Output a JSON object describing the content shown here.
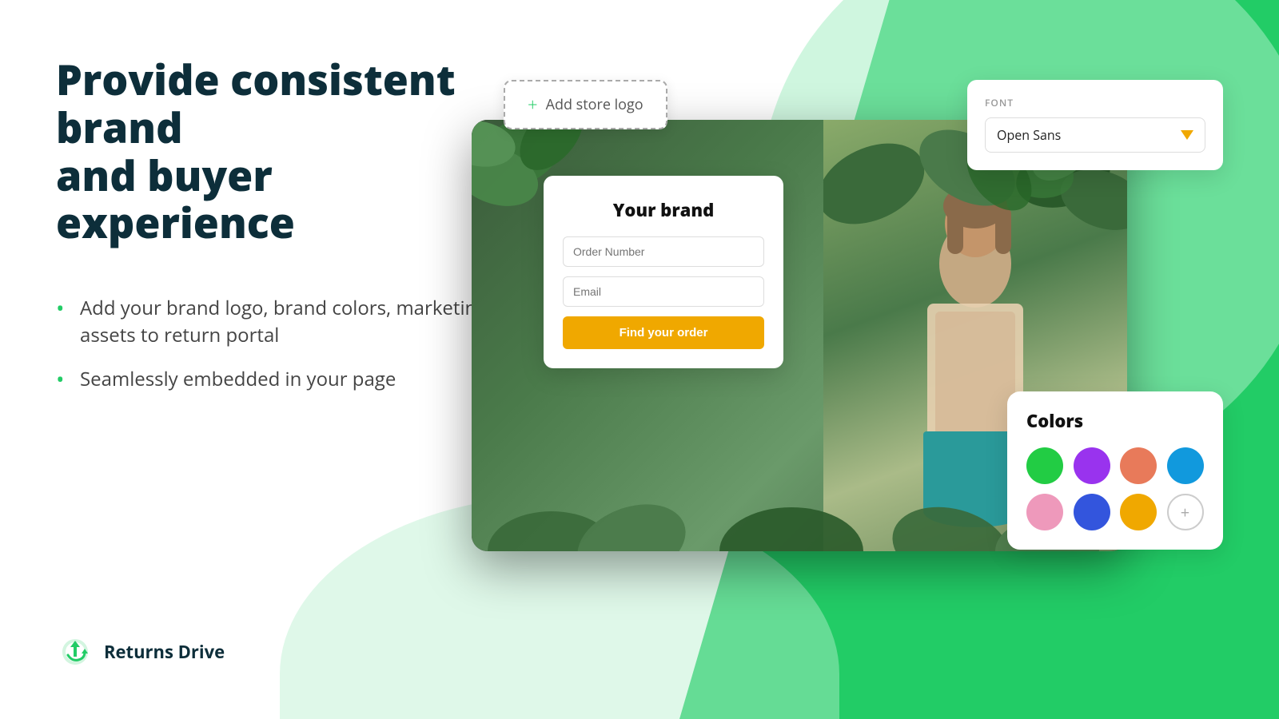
{
  "background": {
    "primary_green": "#22cc66",
    "light_green": "#d4f5e2"
  },
  "heading": {
    "line1": "Provide consistent brand",
    "line2": "and buyer experience"
  },
  "bullets": {
    "item1": "Add your brand logo, brand colors, marketing assets to return portal",
    "item2": "Seamlessly embedded in your page"
  },
  "logo": {
    "text": "Returns Drive"
  },
  "add_logo_button": {
    "label": "Add store logo",
    "icon": "+"
  },
  "font_panel": {
    "label": "FONT",
    "value": "Open Sans"
  },
  "brand_card": {
    "title": "Your brand",
    "order_number_placeholder": "Order Number",
    "email_placeholder": "Email",
    "button_label": "Find your order"
  },
  "colors_panel": {
    "title": "Colors",
    "swatches": [
      {
        "color": "#22cc44",
        "label": "green"
      },
      {
        "color": "#9933ee",
        "label": "purple"
      },
      {
        "color": "#e87a5a",
        "label": "coral"
      },
      {
        "color": "#1199dd",
        "label": "blue"
      },
      {
        "color": "#ee99bb",
        "label": "pink"
      },
      {
        "color": "#3355dd",
        "label": "navy-blue"
      },
      {
        "color": "#f0a800",
        "label": "yellow"
      },
      {
        "color": "add",
        "label": "add"
      }
    ]
  }
}
